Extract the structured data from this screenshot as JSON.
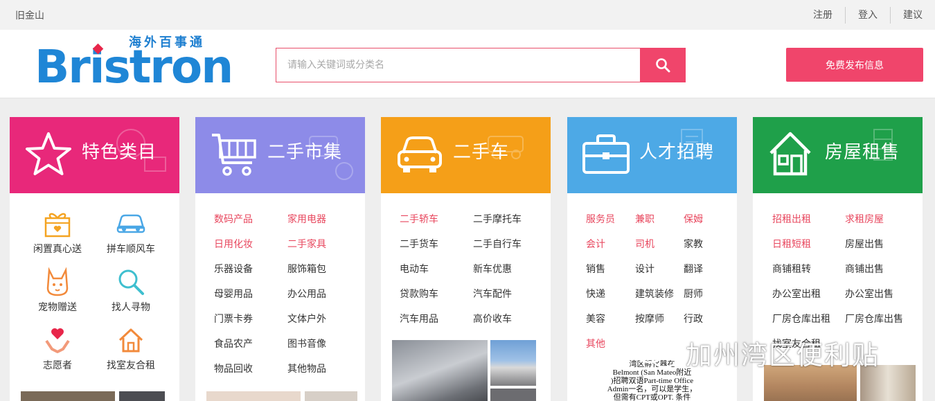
{
  "topbar": {
    "city": "旧金山",
    "links": [
      "注册",
      "登入",
      "建议"
    ]
  },
  "header": {
    "logo_cn": "海外百事通",
    "logo_en": "Bristron",
    "search_placeholder": "请输入关键词或分类名",
    "post_button": "免费发布信息"
  },
  "colors": {
    "accent": "#f0456b",
    "link_red": "#e8475e",
    "card1": "#e8287a",
    "card2": "#8d8be8",
    "card3": "#f59f18",
    "card4": "#4da9e6",
    "card5": "#1fa04a"
  },
  "cards": [
    {
      "title": "特色类目",
      "icon": "star-icon",
      "features": [
        {
          "label": "闲置真心送",
          "icon": "gift-icon"
        },
        {
          "label": "拼车顺风车",
          "icon": "car-icon"
        },
        {
          "label": "宠物赠送",
          "icon": "pet-icon"
        },
        {
          "label": "找人寻物",
          "icon": "magnifier-icon"
        },
        {
          "label": "志愿者",
          "icon": "heart-hands-icon"
        },
        {
          "label": "找室友合租",
          "icon": "house-icon"
        }
      ]
    },
    {
      "title": "二手市集",
      "icon": "cart-icon",
      "links": [
        {
          "text": "数码产品",
          "hot": true
        },
        {
          "text": "家用电器",
          "hot": true
        },
        {
          "text": "日用化妆",
          "hot": true
        },
        {
          "text": "二手家具",
          "hot": true
        },
        {
          "text": "乐器设备",
          "hot": false
        },
        {
          "text": "服饰箱包",
          "hot": false
        },
        {
          "text": "母婴用品",
          "hot": false
        },
        {
          "text": "办公用品",
          "hot": false
        },
        {
          "text": "门票卡券",
          "hot": false
        },
        {
          "text": "文体户外",
          "hot": false
        },
        {
          "text": "食品农产",
          "hot": false
        },
        {
          "text": "图书音像",
          "hot": false
        },
        {
          "text": "物品回收",
          "hot": false
        },
        {
          "text": "其他物品",
          "hot": false
        }
      ]
    },
    {
      "title": "二手车",
      "icon": "car-front-icon",
      "links": [
        {
          "text": "二手轿车",
          "hot": true
        },
        {
          "text": "二手摩托车",
          "hot": false
        },
        {
          "text": "二手货车",
          "hot": false
        },
        {
          "text": "二手自行车",
          "hot": false
        },
        {
          "text": "电动车",
          "hot": false
        },
        {
          "text": "新车优惠",
          "hot": false
        },
        {
          "text": "贷款购车",
          "hot": false
        },
        {
          "text": "汽车配件",
          "hot": false
        },
        {
          "text": "汽车用品",
          "hot": false
        },
        {
          "text": "高价收车",
          "hot": false
        }
      ]
    },
    {
      "title": "人才招聘",
      "icon": "briefcase-icon",
      "links": [
        {
          "text": "服务员",
          "hot": true
        },
        {
          "text": "兼职",
          "hot": true
        },
        {
          "text": "保姆",
          "hot": true
        },
        {
          "text": "会计",
          "hot": true
        },
        {
          "text": "司机",
          "hot": true
        },
        {
          "text": "家教",
          "hot": false
        },
        {
          "text": "销售",
          "hot": false
        },
        {
          "text": "设计",
          "hot": false
        },
        {
          "text": "翻译",
          "hot": false
        },
        {
          "text": "快递",
          "hot": false
        },
        {
          "text": "建筑装修",
          "hot": false
        },
        {
          "text": "厨师",
          "hot": false
        },
        {
          "text": "美容",
          "hot": false
        },
        {
          "text": "按摩师",
          "hot": false
        },
        {
          "text": "行政",
          "hot": false
        },
        {
          "text": "其他",
          "hot": true
        }
      ],
      "poster_lines": [
        "湾区孵化器在",
        "Belmont (San Mateo附近",
        ")招聘双语Part-time Office",
        "Admin一名，可以是学生，",
        "但需有CPT或OPT. 条件"
      ]
    },
    {
      "title": "房屋租售",
      "icon": "home-icon",
      "links": [
        {
          "text": "招租出租",
          "hot": true
        },
        {
          "text": "求租房屋",
          "hot": true
        },
        {
          "text": "日租短租",
          "hot": true
        },
        {
          "text": "房屋出售",
          "hot": false
        },
        {
          "text": "商铺租转",
          "hot": false
        },
        {
          "text": "商铺出售",
          "hot": false
        },
        {
          "text": "办公室出租",
          "hot": false
        },
        {
          "text": "办公室出售",
          "hot": false
        },
        {
          "text": "厂房仓库出租",
          "hot": false
        },
        {
          "text": "厂房仓库出售",
          "hot": false
        },
        {
          "text": "找室友合租",
          "hot": false
        }
      ]
    }
  ],
  "watermark": "加州湾区便利贴"
}
